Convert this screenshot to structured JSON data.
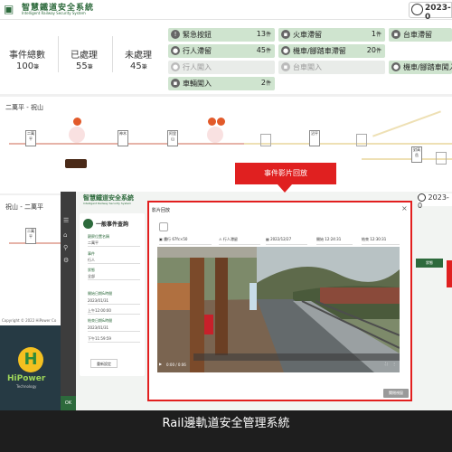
{
  "header": {
    "title": "智慧鐵道安全系統",
    "subtitle": "Intelligent Railway Security System",
    "date": "2023-0"
  },
  "stats": [
    {
      "label": "事件總數",
      "value": "100",
      "unit": "筆"
    },
    {
      "label": "已處理",
      "value": "55",
      "unit": "筆"
    },
    {
      "label": "未處理",
      "value": "45",
      "unit": "筆"
    }
  ],
  "alarms": [
    {
      "label": "緊急按鈕",
      "count": "13",
      "unit": "件",
      "state": "on"
    },
    {
      "label": "火車滯留",
      "count": "1",
      "unit": "件",
      "state": "on"
    },
    {
      "label": "台車滯留",
      "count": "",
      "unit": "",
      "state": "on"
    },
    {
      "label": "行人滯留",
      "count": "45",
      "unit": "件",
      "state": "on"
    },
    {
      "label": "機車/腳踏車滯留",
      "count": "20",
      "unit": "件",
      "state": "on"
    },
    {
      "label": "機車/腳踏車闖入",
      "count": "",
      "unit": "",
      "state": "off"
    },
    {
      "label": "行人闖入",
      "count": "0",
      "unit": "件",
      "state": "off"
    },
    {
      "label": "台車闖入",
      "count": "0",
      "unit": "件",
      "state": "off"
    },
    {
      "label": "車輛闖入",
      "count": "2",
      "unit": "件",
      "state": "on"
    }
  ],
  "routes": [
    {
      "title": "二萬平 - 祝山"
    },
    {
      "title": "祝山 - 二萬平"
    }
  ],
  "stations_top": [
    "二萬平",
    "神木",
    "阿里山",
    "沼平",
    "對高岳"
  ],
  "query_page": {
    "logo": "智慧鐵道安全系統",
    "logo_sub": "Intelligent Railway Security System",
    "title": "一般事件查詢",
    "fields": [
      {
        "label": "觀察位置名稱",
        "value": "二萬平"
      },
      {
        "label": "事件",
        "value": "行人"
      },
      {
        "label": "狀態",
        "value": "未處理"
      },
      {
        "label": "",
        "value": "全部"
      },
      {
        "label": "開始日期&時間",
        "value": "2023/01/31"
      },
      {
        "label": "",
        "value": "上午12:00:00"
      },
      {
        "label": "結束日期&時間",
        "value": "2023/01/31"
      },
      {
        "label": "",
        "value": "下午11:59:59"
      }
    ],
    "reset": "重新設定",
    "copyright": "Copyright © 2022 HiPower Co",
    "right_date": "2023-0",
    "table_head": "狀態"
  },
  "modal": {
    "title": "影片回放",
    "close": "×",
    "camera_label": "畫面",
    "camera": "畫行 67fc×50",
    "event": "行人滯留",
    "date": "2022/12/27",
    "start_label": "開始",
    "start": "12:24:31",
    "end_label": "結束",
    "end": "12:30:31",
    "time": "0:00 / 0:06",
    "button": "關閉視窗"
  },
  "callout": "事件影片回放",
  "brand": {
    "name": "HiPower",
    "sub": "Technology"
  },
  "caption": "Rail邊軌道安全管理系統"
}
